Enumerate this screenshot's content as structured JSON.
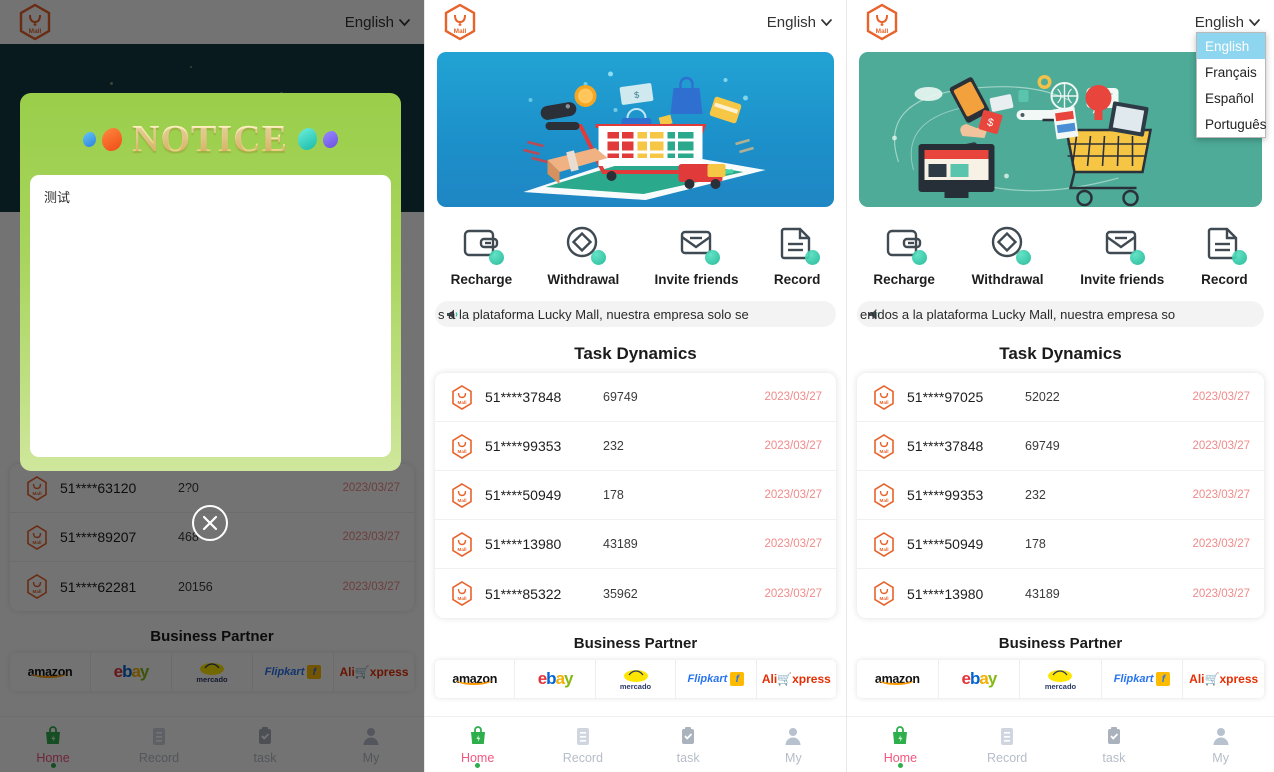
{
  "header": {
    "logo_alt": "Lucky Mall logo",
    "language_label": "English",
    "chevron": "⌄"
  },
  "language_menu": {
    "options": [
      {
        "label": "English",
        "selected": true
      },
      {
        "label": "Français",
        "selected": false
      },
      {
        "label": "Español",
        "selected": false
      },
      {
        "label": "Português",
        "selected": false
      }
    ]
  },
  "banners": {
    "mid": {
      "alt": "E-commerce shopping cart on smartphone banner",
      "bg": "#1f93cc"
    },
    "right": {
      "alt": "Online shopping devices and cart banner",
      "bg": "#4dab97"
    }
  },
  "quick_actions": [
    {
      "label": "Recharge",
      "icon": "wallet-icon"
    },
    {
      "label": "Withdrawal",
      "icon": "diamond-circle-icon"
    },
    {
      "label": "Invite friends",
      "icon": "envelope-icon"
    },
    {
      "label": "Record",
      "icon": "document-icon"
    }
  ],
  "marquee": {
    "mid_text": "s a la plataforma Lucky Mall, nuestra empresa solo se",
    "right_text": "enidos a la plataforma Lucky Mall, nuestra empresa so",
    "icon": "speaker-icon"
  },
  "task_dynamics": {
    "title": "Task Dynamics",
    "mid_rows": [
      {
        "user": "51****37848",
        "amount": "69749",
        "date": "2023/03/27"
      },
      {
        "user": "51****99353",
        "amount": "232",
        "date": "2023/03/27"
      },
      {
        "user": "51****50949",
        "amount": "178",
        "date": "2023/03/27"
      },
      {
        "user": "51****13980",
        "amount": "43189",
        "date": "2023/03/27"
      },
      {
        "user": "51****85322",
        "amount": "35962",
        "date": "2023/03/27"
      }
    ],
    "right_rows": [
      {
        "user": "51****97025",
        "amount": "52022",
        "date": "2023/03/27"
      },
      {
        "user": "51****37848",
        "amount": "69749",
        "date": "2023/03/27"
      },
      {
        "user": "51****99353",
        "amount": "232",
        "date": "2023/03/27"
      },
      {
        "user": "51****50949",
        "amount": "178",
        "date": "2023/03/27"
      },
      {
        "user": "51****13980",
        "amount": "43189",
        "date": "2023/03/27"
      }
    ],
    "left_rows": [
      {
        "user": "51****63120",
        "amount": "2?0",
        "date": "2023/03/27"
      },
      {
        "user": "51****89207",
        "amount": "468",
        "date": "2023/03/27"
      },
      {
        "user": "51****62281",
        "amount": "20156",
        "date": "2023/03/27"
      }
    ]
  },
  "business_partner": {
    "title": "Business Partner",
    "partners": [
      "amazon",
      "ebay",
      "mercado",
      "Flipkart",
      "AliExpress"
    ]
  },
  "bottom_nav": [
    {
      "label": "Home",
      "icon": "bag-icon",
      "active": true
    },
    {
      "label": "Record",
      "icon": "clipboard-icon",
      "active": false
    },
    {
      "label": "task",
      "icon": "task-icon",
      "active": false
    },
    {
      "label": "My",
      "icon": "person-icon",
      "active": false
    }
  ],
  "notice_modal": {
    "title": "NOTICE",
    "body_text": "测试",
    "close_icon": "close-icon"
  },
  "colors": {
    "accent_orange": "#e8622a",
    "date_red": "#f08a8a",
    "active_pink": "#f4577f",
    "teal_dot": "#17b594",
    "notice_green": "#9ace4a",
    "dropdown_highlight": "#8ed6ef"
  }
}
